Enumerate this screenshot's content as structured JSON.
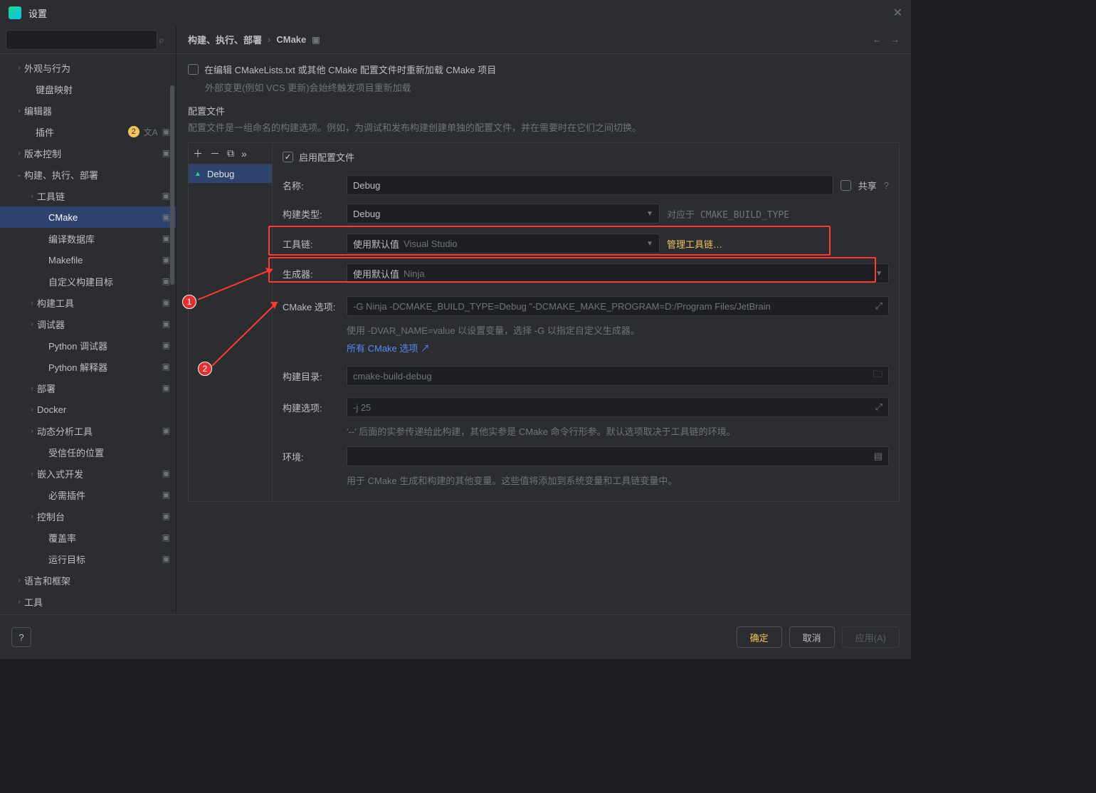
{
  "window": {
    "title": "设置"
  },
  "sidebar": {
    "items": [
      {
        "label": "外观与行为",
        "chev": "›",
        "pad": 20
      },
      {
        "label": "键盘映射",
        "pad": 36
      },
      {
        "label": "编辑器",
        "chev": "›",
        "pad": 20
      },
      {
        "label": "插件",
        "pad": 36,
        "badge": "2",
        "trailIcons": true
      },
      {
        "label": "版本控制",
        "chev": "›",
        "pad": 20,
        "trail": "▣"
      },
      {
        "label": "构建、执行、部署",
        "chev": "⌄",
        "pad": 20,
        "expanded": true
      },
      {
        "label": "工具链",
        "chev": "›",
        "pad": 38,
        "trail": "▣"
      },
      {
        "label": "CMake",
        "pad": 54,
        "trail": "▣",
        "selected": true
      },
      {
        "label": "编译数据库",
        "pad": 54,
        "trail": "▣"
      },
      {
        "label": "Makefile",
        "pad": 54,
        "trail": "▣"
      },
      {
        "label": "自定义构建目标",
        "pad": 54,
        "trail": "▣"
      },
      {
        "label": "构建工具",
        "chev": "›",
        "pad": 38,
        "trail": "▣"
      },
      {
        "label": "调试器",
        "chev": "›",
        "pad": 38,
        "trail": "▣"
      },
      {
        "label": "Python 调试器",
        "pad": 54,
        "trail": "▣"
      },
      {
        "label": "Python 解释器",
        "pad": 54,
        "trail": "▣"
      },
      {
        "label": "部署",
        "chev": "›",
        "pad": 38,
        "trail": "▣"
      },
      {
        "label": "Docker",
        "chev": "›",
        "pad": 38
      },
      {
        "label": "动态分析工具",
        "chev": "›",
        "pad": 38,
        "trail": "▣"
      },
      {
        "label": "受信任的位置",
        "pad": 54
      },
      {
        "label": "嵌入式开发",
        "chev": "›",
        "pad": 38,
        "trail": "▣"
      },
      {
        "label": "必需插件",
        "pad": 54,
        "trail": "▣"
      },
      {
        "label": "控制台",
        "chev": "›",
        "pad": 38,
        "trail": "▣"
      },
      {
        "label": "覆盖率",
        "pad": 54,
        "trail": "▣"
      },
      {
        "label": "运行目标",
        "pad": 54,
        "trail": "▣"
      },
      {
        "label": "语言和框架",
        "chev": "›",
        "pad": 20
      },
      {
        "label": "工具",
        "chev": "›",
        "pad": 20
      }
    ]
  },
  "breadcrumb": {
    "parent": "构建、执行、部署",
    "current": "CMake"
  },
  "page": {
    "reload_checkbox": "在编辑 CMakeLists.txt 或其他 CMake 配置文件时重新加载 CMake 项目",
    "reload_hint": "外部变更(例如 VCS 更新)会始终触发项目重新加载",
    "profiles_title": "配置文件",
    "profiles_hint": "配置文件是一组命名的构建选项。例如，为调试和发布构建创建单独的配置文件，并在需要时在它们之间切换。",
    "profile_name": "Debug",
    "enable_profile": "启用配置文件",
    "share_label": "共享",
    "labels": {
      "name": "名称:",
      "build_type": "构建类型:",
      "toolchain": "工具链:",
      "generator": "生成器:",
      "cmake_options": "CMake 选项:",
      "build_dir": "构建目录:",
      "build_options": "构建选项:",
      "environment": "环境:"
    },
    "values": {
      "name": "Debug",
      "build_type": "Debug",
      "build_type_hint": "对应于 CMAKE_BUILD_TYPE",
      "toolchain_prefix": "使用默认值",
      "toolchain_ghost": "Visual Studio",
      "manage_toolchains": "管理工具链…",
      "generator_prefix": "使用默认值",
      "generator_ghost": "Ninja",
      "cmake_options": "-G Ninja -DCMAKE_BUILD_TYPE=Debug \"-DCMAKE_MAKE_PROGRAM=D:/Program Files/JetBrain",
      "cmake_hint1": "使用 -DVAR_NAME=value 以设置变量，选择 -G 以指定自定义生成器。",
      "cmake_link": "所有 CMake 选项",
      "build_dir": "cmake-build-debug",
      "build_options": "-j 25",
      "build_opts_hint": "'--' 后面的实参传递给此构建，其他实参是 CMake 命令行形参。默认选项取决于工具链的环境。",
      "env_hint": "用于 CMake 生成和构建的其他变量。这些值将添加到系统变量和工具链变量中。"
    },
    "annotations": {
      "a1": "1",
      "a2": "2"
    }
  },
  "footer": {
    "ok": "确定",
    "cancel": "取消",
    "apply": "应用(A)"
  }
}
